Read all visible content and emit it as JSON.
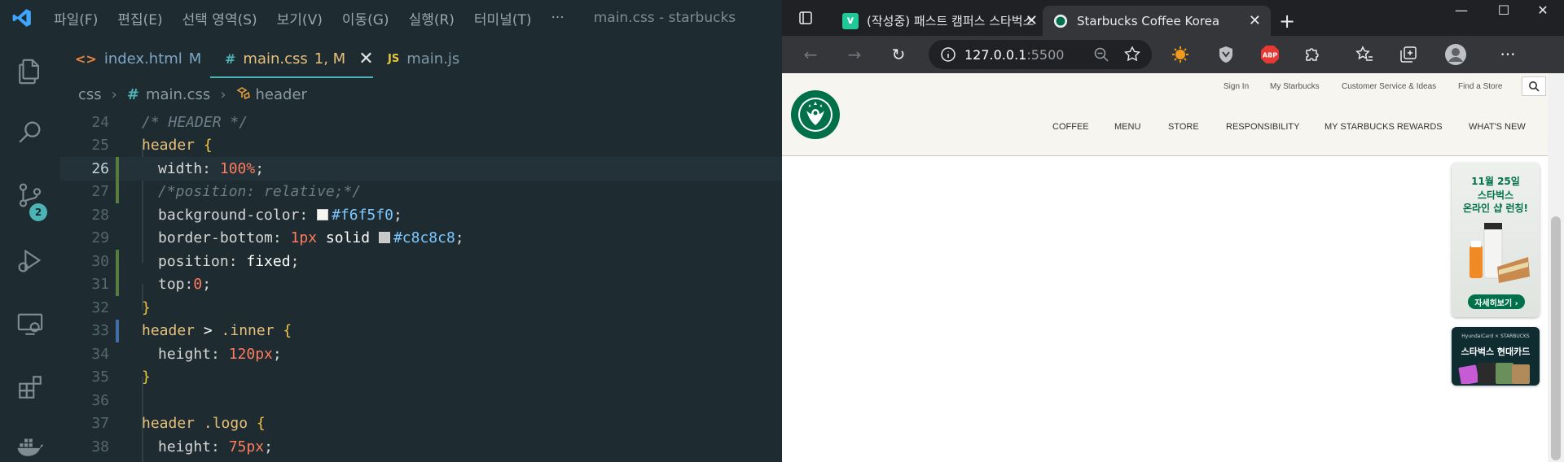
{
  "vscode": {
    "menu": [
      "파일(F)",
      "편집(E)",
      "선택 영역(S)",
      "보기(V)",
      "이동(G)",
      "실행(R)",
      "터미널(T)",
      "···"
    ],
    "window_title": "main.css - starbucks",
    "scm_badge": "2",
    "tabs": [
      {
        "icon": "<>",
        "name": "index.html",
        "status": "M"
      },
      {
        "icon": "#",
        "name": "main.css",
        "status": "1, M",
        "close": "✕"
      },
      {
        "icon": "JS",
        "name": "main.js",
        "status": ""
      }
    ],
    "breadcrumb": {
      "folder": "css",
      "sep1": "›",
      "file": "main.css",
      "sep2": "›",
      "symbol": "header"
    },
    "lines": [
      {
        "n": "24",
        "text": "/* HEADER */"
      },
      {
        "n": "25",
        "text": "header {"
      },
      {
        "n": "26",
        "text": "width: 100%;"
      },
      {
        "n": "27",
        "text": "/*position: relative;*/"
      },
      {
        "n": "28",
        "text": "background-color: #f6f5f0;"
      },
      {
        "n": "29",
        "text": "border-bottom: 1px solid #c8c8c8;"
      },
      {
        "n": "30",
        "text": "position: fixed;"
      },
      {
        "n": "31",
        "text": "top:0;"
      },
      {
        "n": "32",
        "text": "}"
      },
      {
        "n": "33",
        "text": "header > .inner {"
      },
      {
        "n": "34",
        "text": "height: 120px;"
      },
      {
        "n": "35",
        "text": "}"
      },
      {
        "n": "36",
        "text": ""
      },
      {
        "n": "37",
        "text": "header .logo {"
      },
      {
        "n": "38",
        "text": "height: 75px;"
      }
    ],
    "tokens": {
      "l24": "/* HEADER */",
      "l25_sel": "header",
      "l25_brace": "{",
      "l26_prop": "width: ",
      "l26_val": "100%",
      "l26_semi": ";",
      "l27": "/*position: relative;*/",
      "l28_prop": "background-color: ",
      "l28_val": "#f6f5f0",
      "l28_semi": ";",
      "l29_prop": "border-bottom: ",
      "l29_num": "1px",
      "l29_kw": " solid ",
      "l29_val": "#c8c8c8",
      "l29_semi": ";",
      "l30_prop": "position: ",
      "l30_val": "fixed",
      "l30_semi": ";",
      "l31_prop": "top:",
      "l31_val": "0",
      "l31_semi": ";",
      "l32": "}",
      "l33_sel": "header",
      "l33_op": " > ",
      "l33_cls": ".inner",
      "l33_brace": " {",
      "l34_prop": "height: ",
      "l34_val": "120px",
      "l34_semi": ";",
      "l35": "}",
      "l37_sel": "header",
      "l37_cls": " .logo",
      "l37_brace": " {",
      "l38_prop": "height: ",
      "l38_val": "75px",
      "l38_semi": ";"
    },
    "colors": {
      "swatch1": "#f6f5f0",
      "swatch2": "#c8c8c8",
      "accent": "#4db3b5"
    }
  },
  "browser": {
    "tabs": [
      {
        "title": "(작성중) 패스트 캠퍼스 스타벅스",
        "favicon": "v",
        "close": "✕"
      },
      {
        "title": "Starbucks Coffee Korea",
        "close": "✕"
      }
    ],
    "new_tab": "+",
    "window_controls": {
      "minimize": "—",
      "maximize": "☐",
      "close": "✕"
    },
    "url_host": "127.0.0.1",
    "url_port": ":5500",
    "extensions": {
      "abp": "ABP"
    },
    "page": {
      "sub_menu": [
        "Sign In",
        "My Starbucks",
        "Customer Service & Ideas",
        "Find a Store"
      ],
      "main_menu": [
        "COFFEE",
        "MENU",
        "STORE",
        "RESPONSIBILITY",
        "MY STARBUCKS REWARDS",
        "WHAT'S NEW"
      ],
      "promo1": {
        "date": "11월 25일",
        "headline_1": "스타벅스",
        "headline_2": "온라인 샵 런칭!",
        "button": "자세히보기 ›"
      },
      "promo2": {
        "top": "HyundaiCard × STARBUCKS",
        "title": "스타벅스 현대카드"
      }
    }
  }
}
